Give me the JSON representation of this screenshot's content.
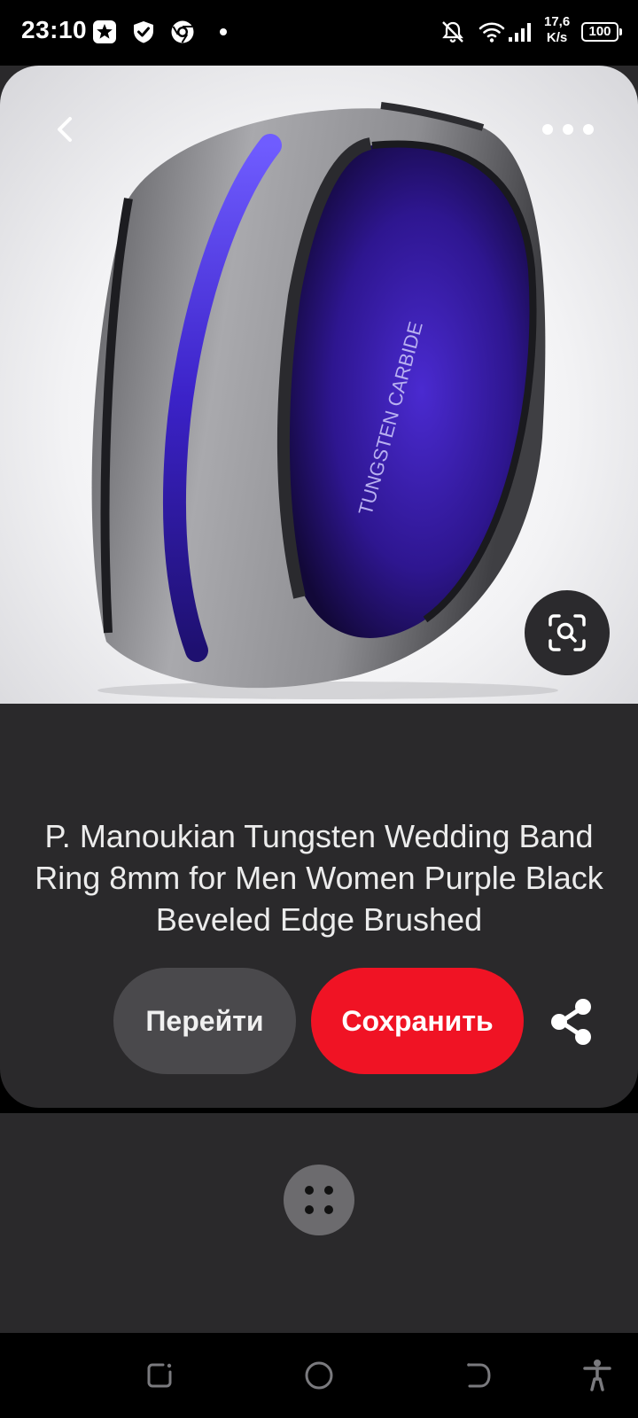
{
  "status_bar": {
    "time": "23:10",
    "net_speed_value": "17,6",
    "net_speed_unit": "K/s",
    "battery": "100",
    "icons": [
      "star-notification-icon",
      "shield-icon",
      "chrome-icon",
      "notifications-off-icon",
      "wifi-icon",
      "cellular-signal-icon"
    ]
  },
  "pin": {
    "image_description_icon": "tungsten-ring-photo",
    "ring_engraving": "TUNGSTEN CARBIDE",
    "title": "P. Manoukian Tungsten Wedding Band Ring 8mm for Men Women Purple Black Beveled Edge Brushed"
  },
  "actions": {
    "visit_label": "Перейти",
    "save_label": "Сохранить"
  },
  "colors": {
    "save_button": "#f01324",
    "card_background": "#2a292b",
    "ring_inner": "#3a1fb0"
  }
}
